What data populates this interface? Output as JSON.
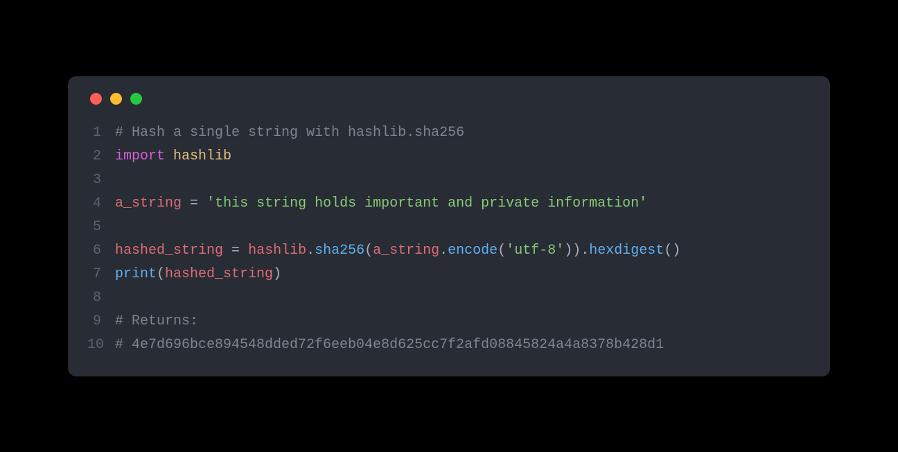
{
  "window": {
    "traffic_light_colors": {
      "close": "#ff5f56",
      "minimize": "#ffbd2e",
      "zoom": "#27c93f"
    }
  },
  "code": {
    "language": "python",
    "lines": [
      {
        "n": "1",
        "tokens": [
          {
            "cls": "tok-comment",
            "t": "# Hash a single string with hashlib.sha256"
          }
        ]
      },
      {
        "n": "2",
        "tokens": [
          {
            "cls": "tok-keyword",
            "t": "import"
          },
          {
            "cls": "tok-plain",
            "t": " "
          },
          {
            "cls": "tok-module",
            "t": "hashlib"
          }
        ]
      },
      {
        "n": "3",
        "tokens": [
          {
            "cls": "tok-plain",
            "t": ""
          }
        ]
      },
      {
        "n": "4",
        "tokens": [
          {
            "cls": "tok-var",
            "t": "a_string"
          },
          {
            "cls": "tok-plain",
            "t": " "
          },
          {
            "cls": "tok-op",
            "t": "="
          },
          {
            "cls": "tok-plain",
            "t": " "
          },
          {
            "cls": "tok-string",
            "t": "'this string holds important and private information'"
          }
        ]
      },
      {
        "n": "5",
        "tokens": [
          {
            "cls": "tok-plain",
            "t": ""
          }
        ]
      },
      {
        "n": "6",
        "tokens": [
          {
            "cls": "tok-var",
            "t": "hashed_string"
          },
          {
            "cls": "tok-plain",
            "t": " "
          },
          {
            "cls": "tok-op",
            "t": "="
          },
          {
            "cls": "tok-plain",
            "t": " "
          },
          {
            "cls": "tok-var",
            "t": "hashlib"
          },
          {
            "cls": "tok-punc",
            "t": "."
          },
          {
            "cls": "tok-call",
            "t": "sha256"
          },
          {
            "cls": "tok-punc",
            "t": "("
          },
          {
            "cls": "tok-var",
            "t": "a_string"
          },
          {
            "cls": "tok-punc",
            "t": "."
          },
          {
            "cls": "tok-call",
            "t": "encode"
          },
          {
            "cls": "tok-punc",
            "t": "("
          },
          {
            "cls": "tok-string",
            "t": "'utf-8'"
          },
          {
            "cls": "tok-punc",
            "t": "))."
          },
          {
            "cls": "tok-call",
            "t": "hexdigest"
          },
          {
            "cls": "tok-punc",
            "t": "()"
          }
        ]
      },
      {
        "n": "7",
        "tokens": [
          {
            "cls": "tok-call",
            "t": "print"
          },
          {
            "cls": "tok-punc",
            "t": "("
          },
          {
            "cls": "tok-var",
            "t": "hashed_string"
          },
          {
            "cls": "tok-punc",
            "t": ")"
          }
        ]
      },
      {
        "n": "8",
        "tokens": [
          {
            "cls": "tok-plain",
            "t": ""
          }
        ]
      },
      {
        "n": "9",
        "tokens": [
          {
            "cls": "tok-comment",
            "t": "# Returns:"
          }
        ]
      },
      {
        "n": "10",
        "tokens": [
          {
            "cls": "tok-comment",
            "t": "# 4e7d696bce894548dded72f6eeb04e8d625cc7f2afd08845824a4a8378b428d1"
          }
        ]
      }
    ]
  }
}
